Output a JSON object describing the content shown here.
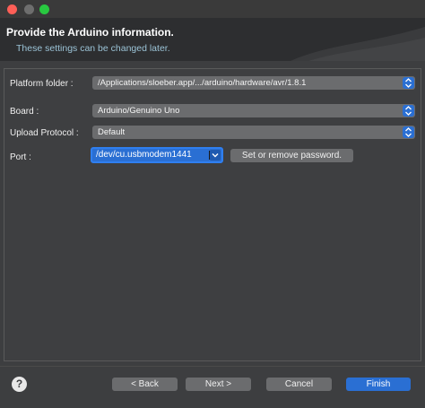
{
  "header": {
    "title": "Provide the Arduino information.",
    "subtitle": "These settings can be changed later."
  },
  "form": {
    "platform_label": "Platform folder :",
    "platform_value": "/Applications/sloeber.app/.../arduino/hardware/avr/1.8.1",
    "board_label": "Board :",
    "board_value": "Arduino/Genuino Uno",
    "upload_label": "Upload Protocol :",
    "upload_value": "Default",
    "port_label": "Port :",
    "port_value": "/dev/cu.usbmodem1441",
    "password_button": "Set or remove password."
  },
  "footer": {
    "help_glyph": "?",
    "back_label": "< Back",
    "next_label": "Next >",
    "cancel_label": "Cancel",
    "finish_label": "Finish"
  },
  "colors": {
    "accent": "#2a6fd3",
    "header_bg": "#2d2e30",
    "window_bg": "#3d3e40"
  }
}
